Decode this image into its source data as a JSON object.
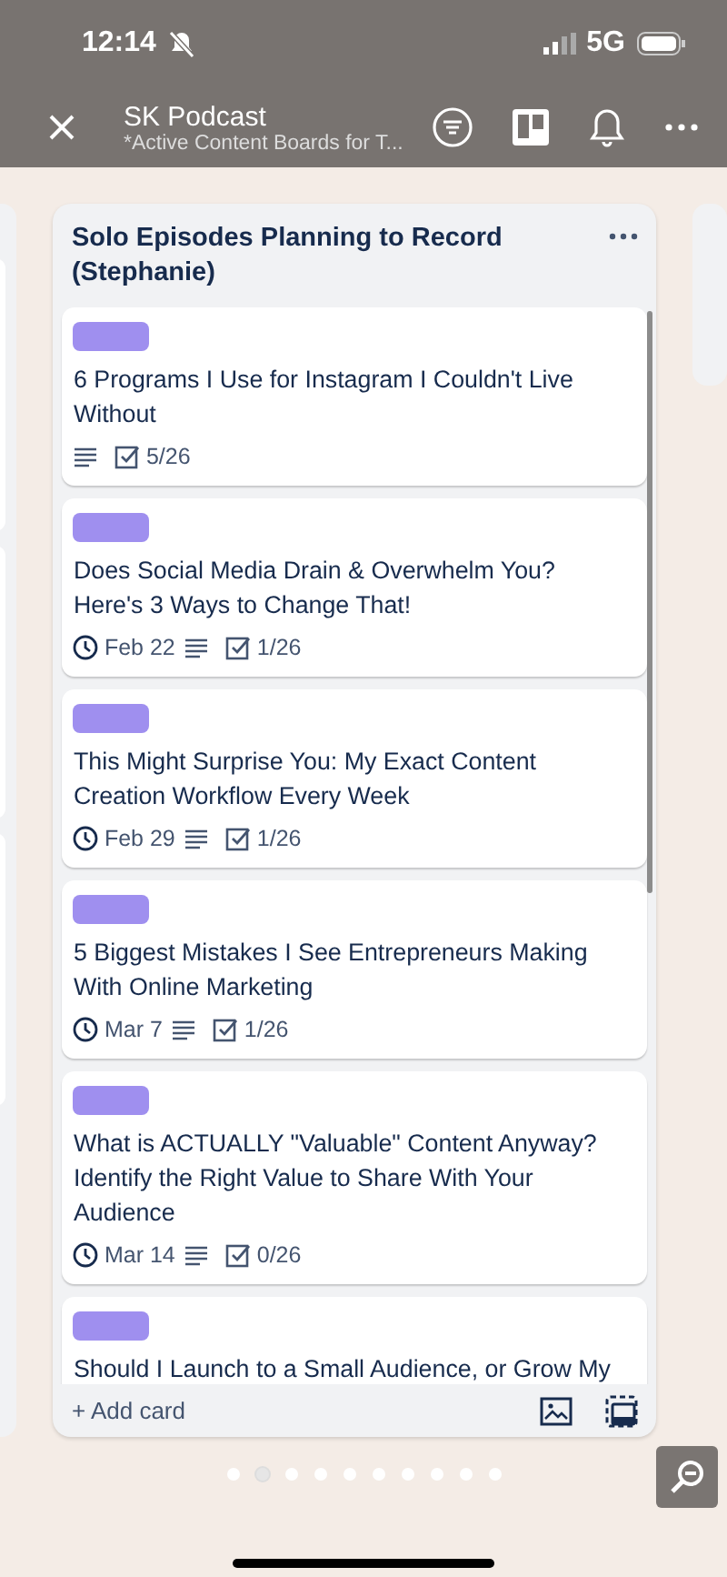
{
  "status_bar": {
    "time": "12:14",
    "network": "5G"
  },
  "header": {
    "title": "SK Podcast",
    "subtitle": "*Active Content Boards for T..."
  },
  "list": {
    "title": "Solo Episodes Planning to Record (Stephanie)",
    "cards": [
      {
        "title": "6 Programs I Use for Instagram I Couldn't Live Without",
        "checklist": "5/26"
      },
      {
        "title": "Does Social Media Drain & Overwhelm You? Here's 3 Ways to Change That!",
        "due": "Feb 22",
        "checklist": "1/26"
      },
      {
        "title": "This Might Surprise You: My Exact Content Creation Workflow Every Week",
        "due": "Feb 29",
        "checklist": "1/26"
      },
      {
        "title": "5 Biggest Mistakes I See Entrepreneurs Making With Online Marketing",
        "due": "Mar 7",
        "checklist": "1/26"
      },
      {
        "title": "What is ACTUALLY \"Valuable\" Content Anyway? Identify the Right Value to Share With Your Audience",
        "due": "Mar 14",
        "checklist": "0/26"
      },
      {
        "title": "Should I Launch to a Small Audience, or Grow My"
      }
    ],
    "add_card": "+ Add card"
  },
  "page_dots": [
    {
      "selected": false
    },
    {
      "selected": true
    },
    {
      "selected": false
    },
    {
      "selected": false
    },
    {
      "selected": false
    },
    {
      "selected": false
    },
    {
      "selected": false
    },
    {
      "selected": false
    },
    {
      "selected": false
    },
    {
      "selected": false
    }
  ]
}
